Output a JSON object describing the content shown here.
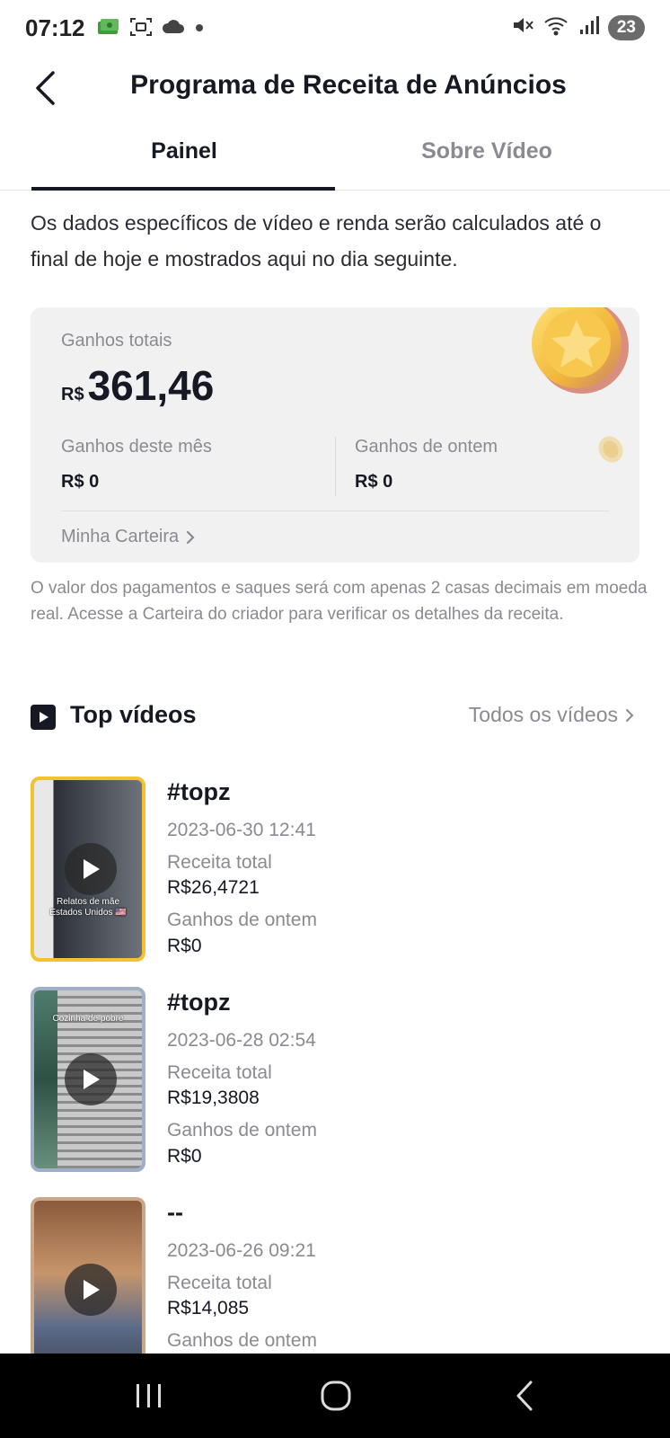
{
  "status_bar": {
    "time": "07:12",
    "battery": "23",
    "left_icons": [
      "money-icon",
      "screenshot-icon",
      "cloud-icon",
      "dot-icon"
    ],
    "right_icons": [
      "mute-icon",
      "wifi-icon",
      "signal-icon"
    ]
  },
  "header": {
    "title": "Programa de Receita de Anúncios"
  },
  "tabs": [
    {
      "label": "Painel",
      "active": true
    },
    {
      "label": "Sobre Vídeo",
      "active": false
    }
  ],
  "notice": "Os dados específicos de vídeo e renda serão calculados até o final de hoje e mostrados aqui no dia seguinte.",
  "earnings": {
    "total_label": "Ganhos totais",
    "currency": "R$",
    "total_value": "361,46",
    "month_label": "Ganhos deste mês",
    "month_value": "R$ 0",
    "yesterday_label": "Ganhos de ontem",
    "yesterday_value": "R$ 0",
    "wallet_link": "Minha Carteira"
  },
  "disclaimer": "O valor dos pagamentos e saques será com apenas 2 casas decimais em moeda real. Acesse a Carteira do criador para verificar os detalhes da receita.",
  "top_videos": {
    "title": "Top vídeos",
    "all_link": "Todos os vídeos",
    "items": [
      {
        "title": "#topz",
        "date": "2023-06-30 12:41",
        "revenue_label": "Receita total",
        "revenue": "R$26,4721",
        "yesterday_label": "Ganhos de ontem",
        "yesterday": "R$0",
        "thumb_caption": "Relatos de mãe\nEstados Unidos 🇺🇸"
      },
      {
        "title": "#topz",
        "date": "2023-06-28 02:54",
        "revenue_label": "Receita total",
        "revenue": "R$19,3808",
        "yesterday_label": "Ganhos de ontem",
        "yesterday": "R$0",
        "thumb_caption": "Cozinha de pobre"
      },
      {
        "title": "--",
        "date": "2023-06-26 09:21",
        "revenue_label": "Receita total",
        "revenue": "R$14,085",
        "yesterday_label": "Ganhos de ontem",
        "yesterday": ""
      }
    ]
  },
  "nav_bar": {
    "buttons": [
      "recent-apps-icon",
      "home-icon",
      "back-icon"
    ]
  }
}
